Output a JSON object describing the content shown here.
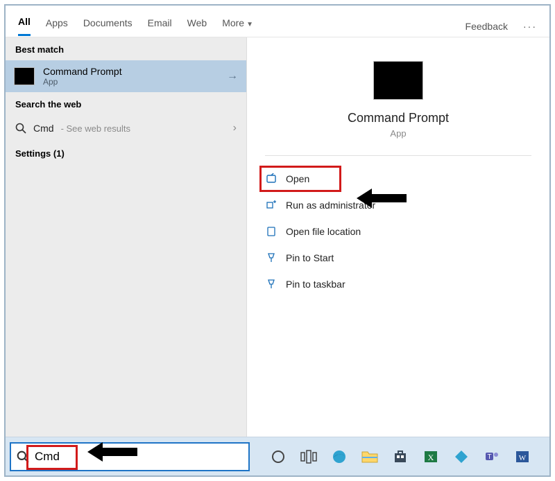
{
  "tabs": {
    "items": [
      "All",
      "Apps",
      "Documents",
      "Email",
      "Web"
    ],
    "more": "More",
    "active_index": 0,
    "feedback": "Feedback"
  },
  "left": {
    "best_match_header": "Best match",
    "best_match": {
      "title": "Command Prompt",
      "subtitle": "App"
    },
    "web_header": "Search the web",
    "web_row": {
      "query": "Cmd",
      "hint": "- See web results"
    },
    "settings_header": "Settings (1)"
  },
  "preview": {
    "title": "Command Prompt",
    "subtitle": "App"
  },
  "actions": {
    "open": "Open",
    "run_admin": "Run as administrator",
    "open_loc": "Open file location",
    "pin_start": "Pin to Start",
    "pin_taskbar": "Pin to taskbar"
  },
  "taskbar": {
    "search_value": "Cmd",
    "icons": [
      "cortana",
      "taskview",
      "edge",
      "explorer",
      "store",
      "excel",
      "kodi",
      "teams",
      "word"
    ]
  }
}
